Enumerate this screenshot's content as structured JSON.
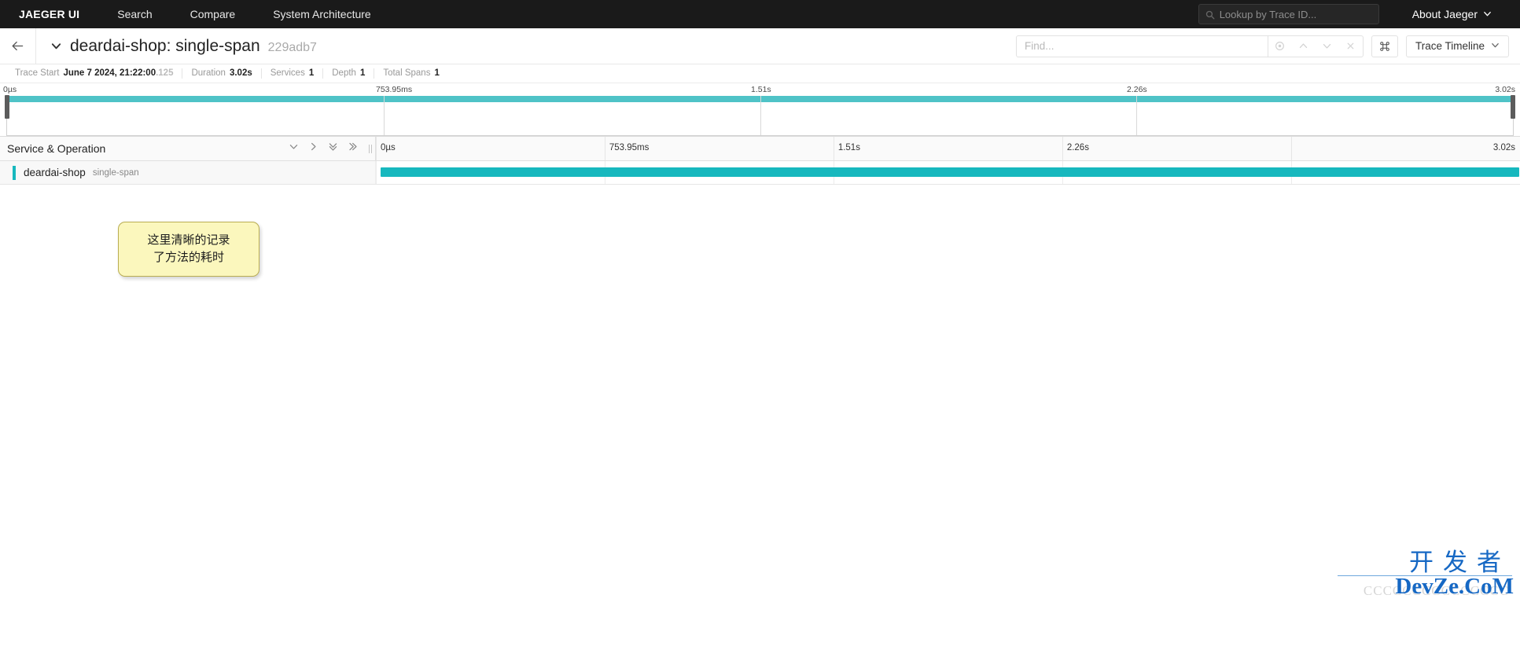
{
  "topnav": {
    "brand": "JAEGER UI",
    "links": [
      {
        "label": "Search"
      },
      {
        "label": "Compare"
      },
      {
        "label": "System Architecture"
      }
    ],
    "lookup_placeholder": "Lookup by Trace ID...",
    "about_label": "About Jaeger"
  },
  "trace_header": {
    "title": "deardai-shop: single-span",
    "trace_id": "229adb7",
    "find_placeholder": "Find...",
    "view_label": "Trace Timeline"
  },
  "meta": [
    {
      "key": "Trace Start",
      "value": "June 7 2024, 21:22:00",
      "value_dim": ".125"
    },
    {
      "key": "Duration",
      "value": "3.02s",
      "value_dim": ""
    },
    {
      "key": "Services",
      "value": "1",
      "value_dim": ""
    },
    {
      "key": "Depth",
      "value": "1",
      "value_dim": ""
    },
    {
      "key": "Total Spans",
      "value": "1",
      "value_dim": ""
    }
  ],
  "minimap": {
    "ticks": [
      {
        "label": "0µs",
        "pct": 0
      },
      {
        "label": "753.95ms",
        "pct": 25
      },
      {
        "label": "1.51s",
        "pct": 50
      },
      {
        "label": "2.26s",
        "pct": 75
      },
      {
        "label": "3.02s",
        "pct": 100
      }
    ]
  },
  "span_table": {
    "column_header": "Service & Operation",
    "ticks": [
      {
        "label": "0µs",
        "pct": 0
      },
      {
        "label": "753.95ms",
        "pct": 25
      },
      {
        "label": "1.51s",
        "pct": 50
      },
      {
        "label": "2.26s",
        "pct": 75
      },
      {
        "label": "3.02s",
        "pct": 100
      }
    ],
    "rows": [
      {
        "service": "deardai-shop",
        "operation": "single-span",
        "bar_start_pct": 0.4,
        "bar_width_pct": 99.5
      }
    ]
  },
  "annotation": {
    "line1": "这里清晰的记录",
    "line2": "了方法的耗时"
  },
  "watermark": {
    "cn": "开发者",
    "en": "DevZe.CoM",
    "ghost": "CCCCCCCCCCCCCCC"
  },
  "colors": {
    "accent_teal": "#17b8be",
    "minimap_teal": "#4fc3c7",
    "nav_bg": "#1a1a1a",
    "annotation_bg": "#fbf7bd",
    "watermark_blue": "#1668c4"
  }
}
